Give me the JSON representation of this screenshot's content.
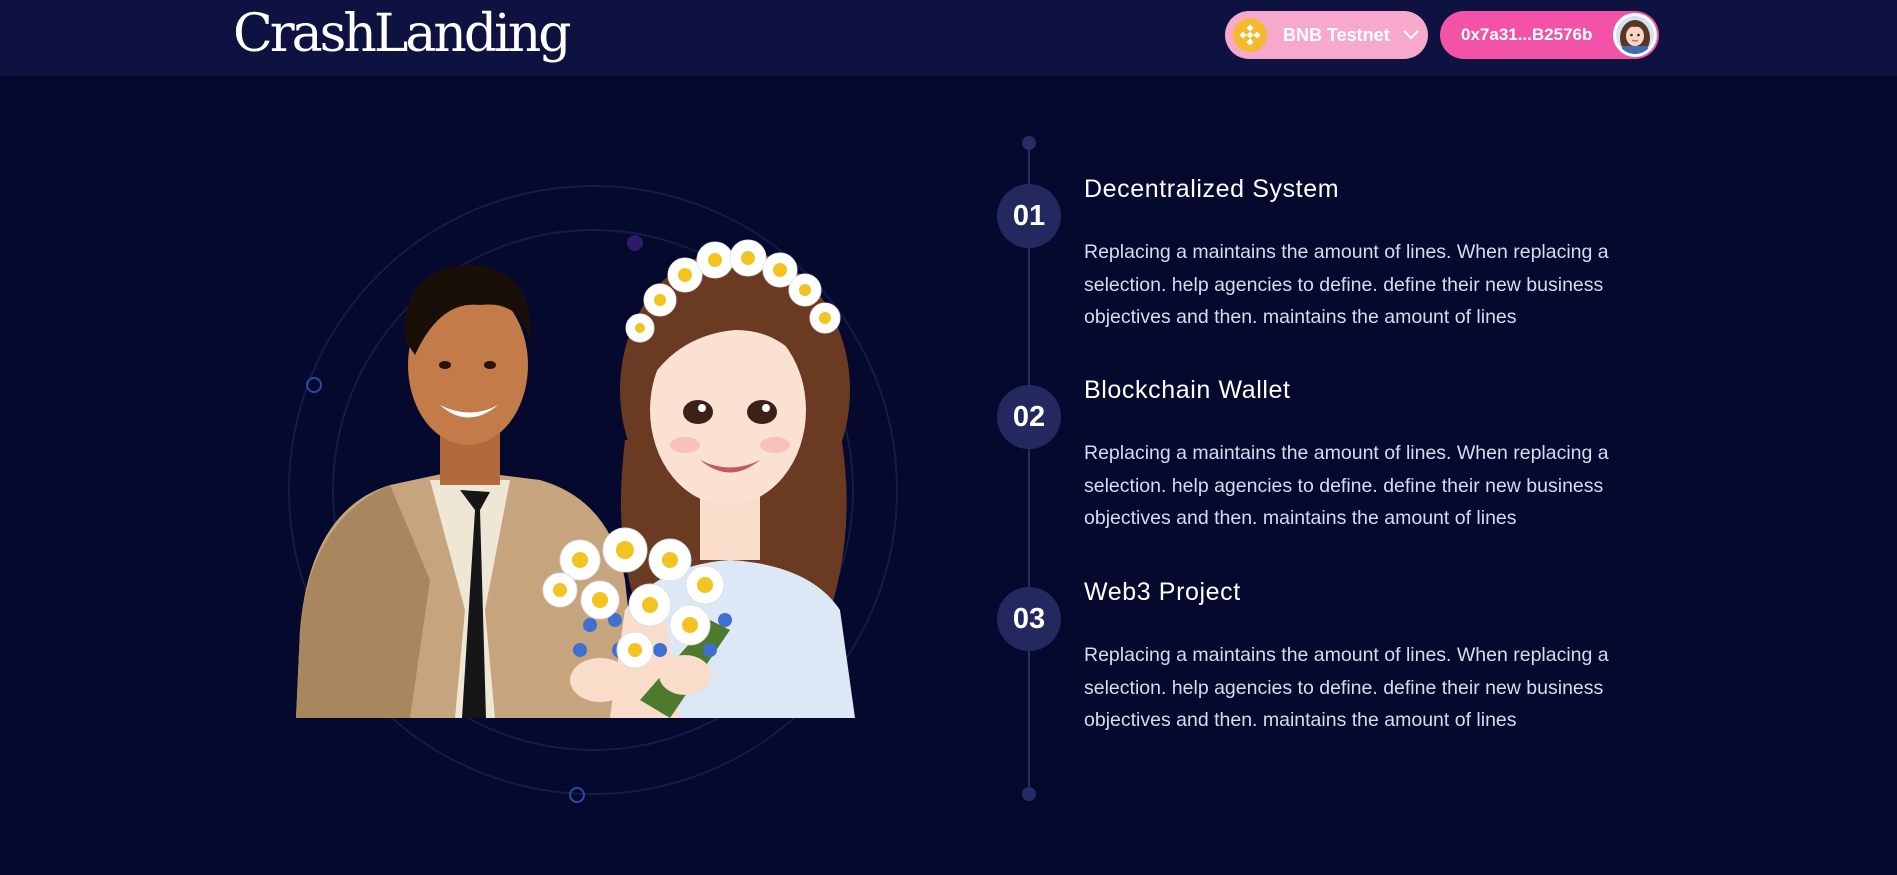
{
  "header": {
    "logo": "CrashLanding",
    "network": {
      "label": "BNB Testnet",
      "icon": "bnb-coin-icon"
    },
    "wallet": {
      "address": "0x7a31...B2576b",
      "avatar": "user-avatar"
    }
  },
  "illustration": {
    "description_icon": "couple-with-flowers-illustration"
  },
  "features": [
    {
      "number": "01",
      "title": "Decentralized System",
      "description": "Replacing a maintains the amount of lines. When replacing a selection. help agencies to define. define their new business objectives and then. maintains the amount of lines"
    },
    {
      "number": "02",
      "title": "Blockchain Wallet",
      "description": "Replacing a maintains the amount of lines. When replacing a selection. help agencies to define. define their new business objectives and then. maintains the amount of lines"
    },
    {
      "number": "03",
      "title": "Web3 Project",
      "description": "Replacing a maintains the amount of lines. When replacing a selection. help agencies to define. define their new business objectives and then. maintains the amount of lines"
    }
  ],
  "colors": {
    "background": "#05092e",
    "header": "#0d1240",
    "network_button": "#f6a9cc",
    "wallet_button": "#f253a6",
    "number_badge": "#23285e"
  }
}
